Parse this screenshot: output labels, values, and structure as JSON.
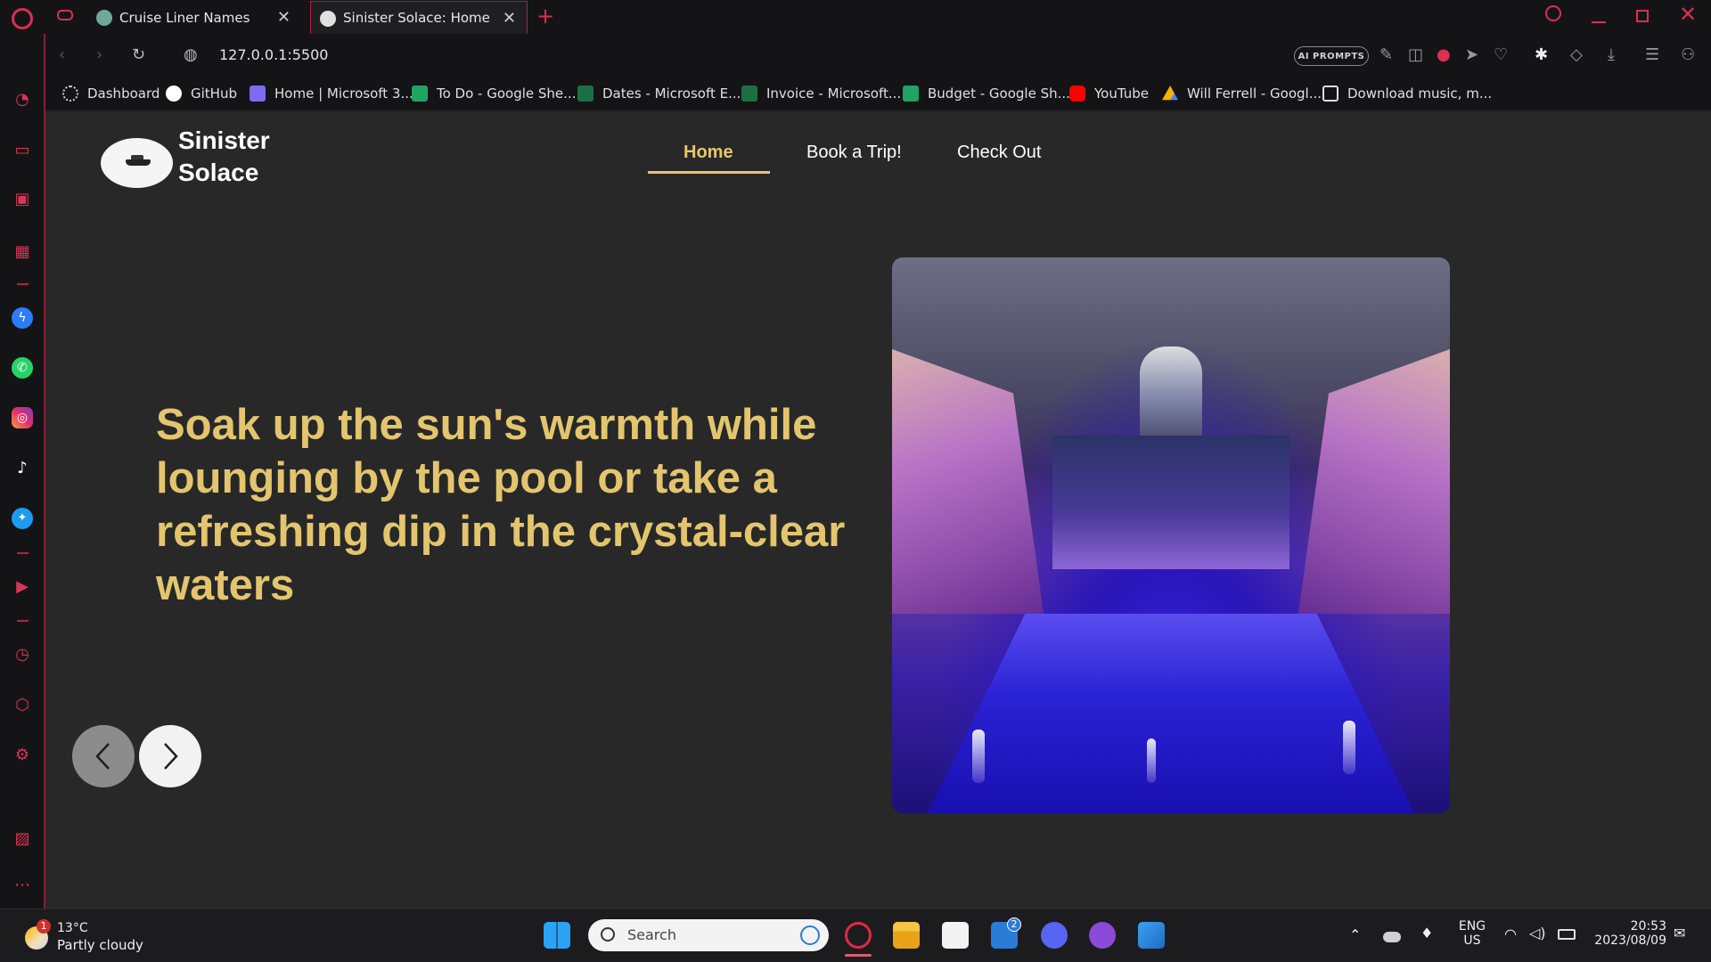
{
  "browser": {
    "tabs": [
      {
        "title": "Cruise Liner Names",
        "active": false
      },
      {
        "title": "Sinister Solace: Home",
        "active": true
      }
    ],
    "url": "127.0.0.1:5500",
    "ai_prompts_label": "AI PROMPTS",
    "bookmarks": [
      {
        "label": "Dashboard",
        "icon": "dashboard-icon",
        "color": "#cfcfcf"
      },
      {
        "label": "GitHub",
        "icon": "github-icon",
        "color": "#ffffff"
      },
      {
        "label": "Home | Microsoft 3...",
        "icon": "microsoft365-icon",
        "color": "#7b6cf0"
      },
      {
        "label": "To Do - Google She...",
        "icon": "google-sheets-icon",
        "color": "#1fa463"
      },
      {
        "label": "Dates - Microsoft E...",
        "icon": "excel-icon",
        "color": "#1d7044"
      },
      {
        "label": "Invoice - Microsoft...",
        "icon": "excel-icon",
        "color": "#1d7044"
      },
      {
        "label": "Budget - Google Sh...",
        "icon": "google-sheets-icon",
        "color": "#1fa463"
      },
      {
        "label": "YouTube",
        "icon": "youtube-icon",
        "color": "#ff0000"
      },
      {
        "label": "Will Ferrell - Googl...",
        "icon": "google-drive-icon",
        "color": "#f4b400"
      },
      {
        "label": "Download music, m...",
        "icon": "download-music-icon",
        "color": "#dddddd"
      }
    ]
  },
  "site": {
    "name_line1": "Sinister",
    "name_line2": "Solace",
    "nav": [
      {
        "label": "Home",
        "active": true
      },
      {
        "label": "Book a Trip!",
        "active": false
      },
      {
        "label": "Check Out",
        "active": false
      }
    ],
    "hero_text": "Soak up the sun's warmth while lounging by the pool or take a refreshing dip in the crystal-clear waters",
    "accent_color": "#e3c56e"
  },
  "taskbar": {
    "weather_temp": "13°C",
    "weather_desc": "Partly cloudy",
    "weather_badge": "1",
    "search_placeholder": "Search",
    "mail_badge": "2",
    "lang_line1": "ENG",
    "lang_line2": "US",
    "time": "20:53",
    "date": "2023/08/09"
  }
}
